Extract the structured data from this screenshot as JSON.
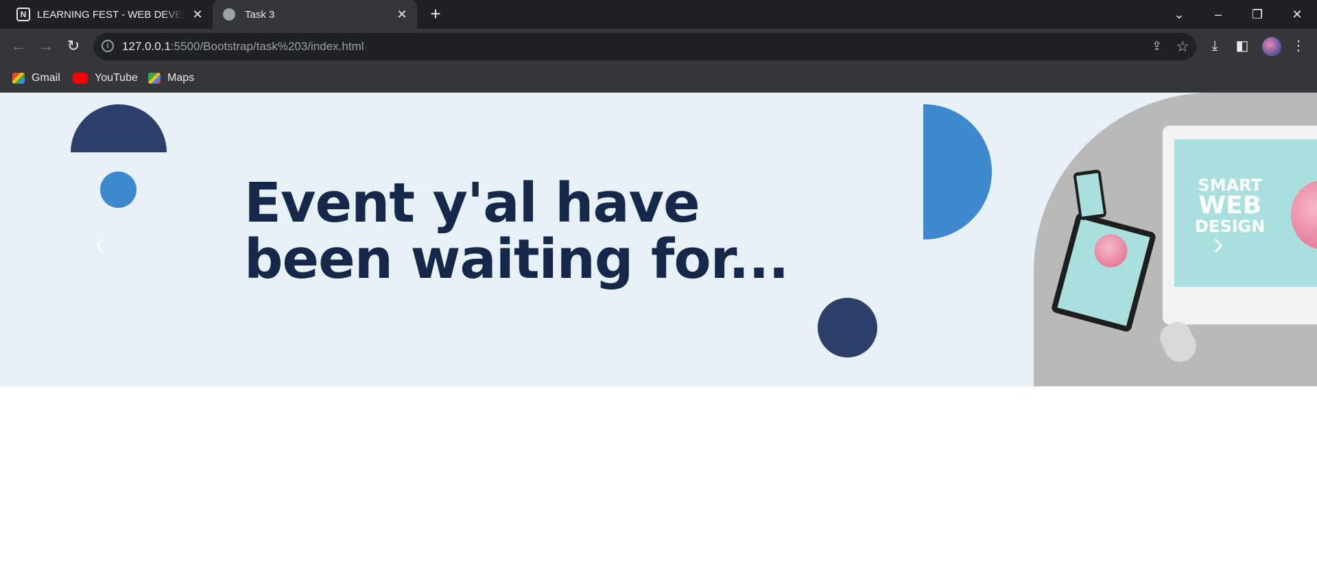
{
  "browser": {
    "tabs": [
      {
        "title": "LEARNING FEST - WEB DEVELOPMENT",
        "favicon": "notion-icon",
        "active": false
      },
      {
        "title": "Task 3",
        "favicon": "globe-icon",
        "active": true
      }
    ],
    "url_host": "127.0.0.1",
    "url_rest": ":5500/Bootstrap/task%203/index.html",
    "bookmarks": [
      {
        "label": "Gmail",
        "icon": "gmail-icon"
      },
      {
        "label": "YouTube",
        "icon": "youtube-icon"
      },
      {
        "label": "Maps",
        "icon": "maps-icon"
      }
    ]
  },
  "hero": {
    "heading_line1": "Event y'al have",
    "heading_line2": "been waiting for...",
    "image_text_line1": "SMART",
    "image_text_line2": "WEB",
    "image_text_line3": "DESIGN",
    "prev_control": "‹",
    "next_control": "›"
  },
  "colors": {
    "hero_background": "#e9f1f8",
    "heading": "#15284a",
    "navy": "#2c3f6b",
    "blue": "#3d88cf"
  }
}
